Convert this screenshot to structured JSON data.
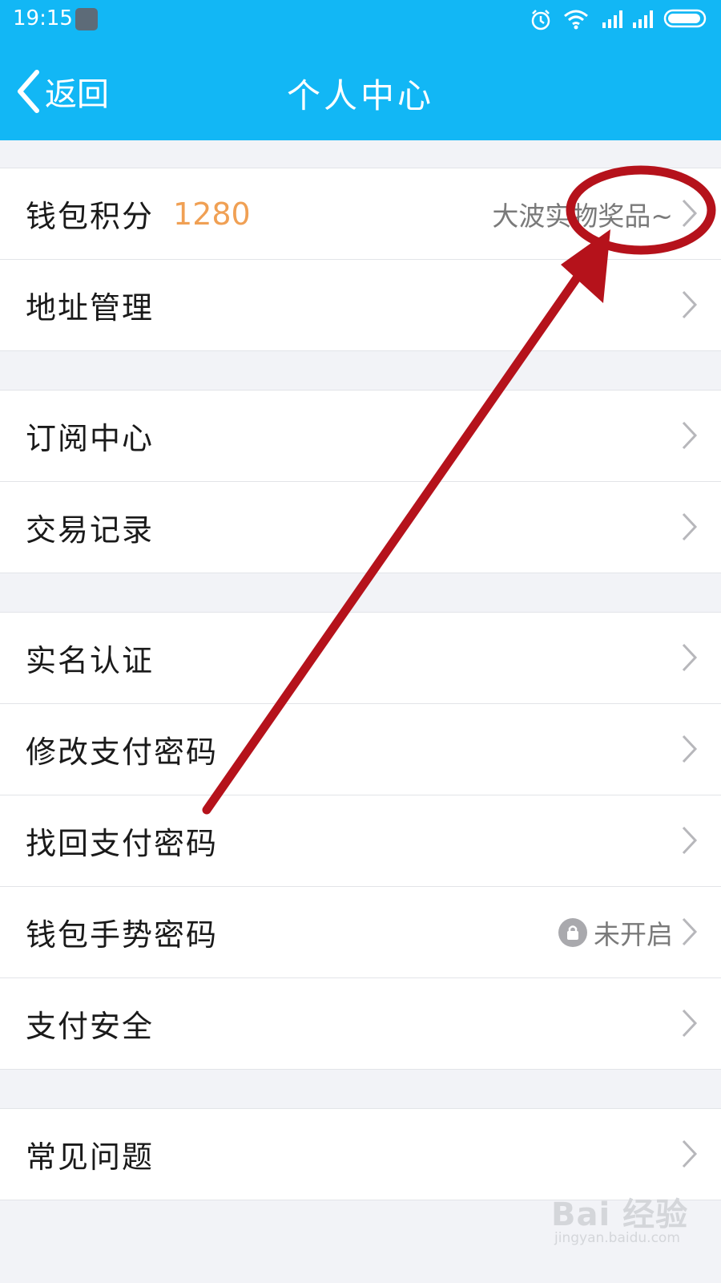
{
  "status_bar": {
    "time": "19:15",
    "icons": [
      "app-notification-icon",
      "alarm-icon",
      "wifi-icon",
      "signal-icon",
      "signal-icon",
      "battery-icon"
    ]
  },
  "nav": {
    "back_label": "返回",
    "title": "个人中心"
  },
  "groups": [
    {
      "rows": [
        {
          "label": "钱包积分",
          "value": "1280",
          "right_text": "大波实物奖品~"
        },
        {
          "label": "地址管理"
        }
      ]
    },
    {
      "rows": [
        {
          "label": "订阅中心"
        },
        {
          "label": "交易记录"
        }
      ]
    },
    {
      "rows": [
        {
          "label": "实名认证"
        },
        {
          "label": "修改支付密码"
        },
        {
          "label": "找回支付密码"
        },
        {
          "label": "钱包手势密码",
          "right_text": "未开启",
          "right_icon": "lock-icon"
        },
        {
          "label": "支付安全"
        }
      ]
    },
    {
      "rows": [
        {
          "label": "常见问题"
        }
      ]
    }
  ],
  "colors": {
    "header": "#12b7f5",
    "points_value": "#f0a054",
    "annotation": "#b5121b"
  },
  "watermark": {
    "brand": "Bai 经验",
    "sub": "jingyan.baidu.com"
  }
}
